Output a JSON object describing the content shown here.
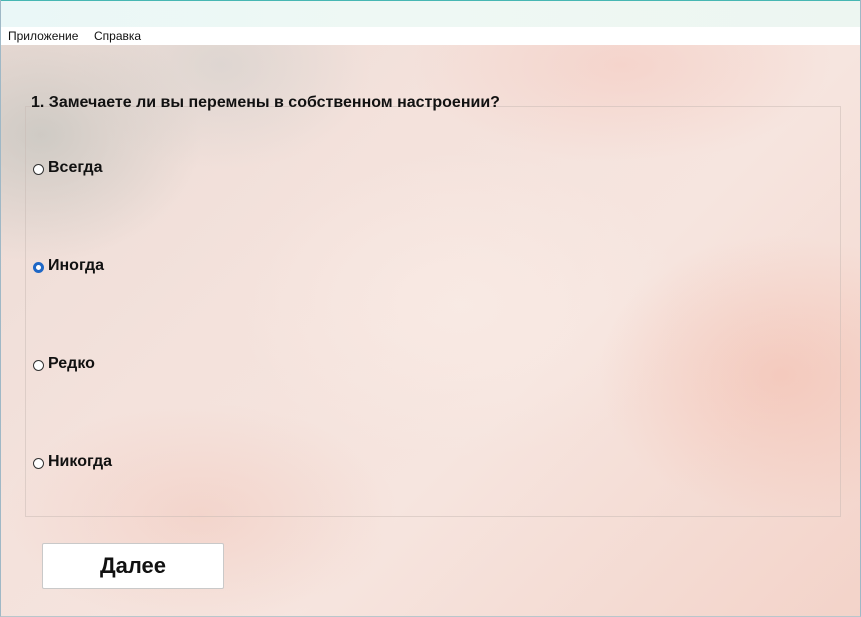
{
  "menu": {
    "items": [
      "Приложение",
      "Справка"
    ]
  },
  "question": {
    "text": "1. Замечаете ли вы перемены в собственном настроении?",
    "options": [
      "Всегда",
      "Иногда",
      "Редко",
      "Никогда"
    ],
    "selected": "Иногда"
  },
  "buttons": {
    "next_label": "Далее"
  },
  "colors": {
    "radio_selected": "#1e67c6",
    "titlebar_accent": "#46b7b3"
  }
}
